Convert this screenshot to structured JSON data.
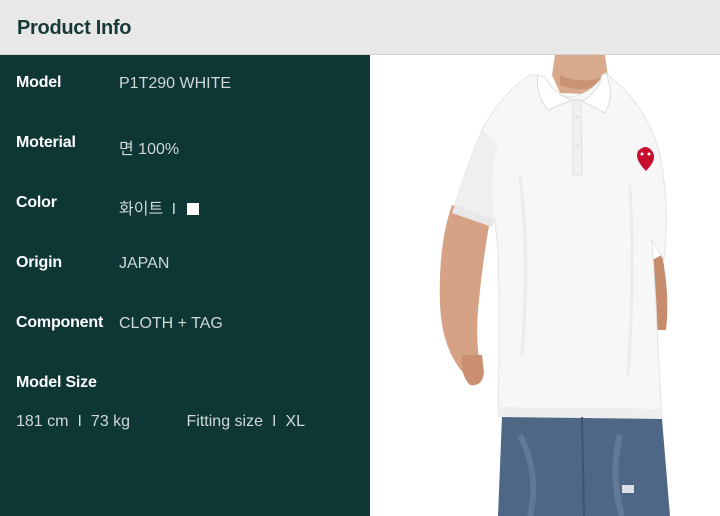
{
  "header": {
    "title": "Product Info"
  },
  "info": [
    {
      "label": "Model",
      "value": "P1T290 WHITE"
    },
    {
      "label": "Moterial",
      "value": "면 100%"
    },
    {
      "label": "Color",
      "value": "화이트",
      "separator": "I"
    },
    {
      "label": "Origin",
      "value": "JAPAN"
    },
    {
      "label": "Component",
      "value": "CLOTH + TAG"
    }
  ],
  "model_size": {
    "label": "Model Size",
    "height": "181 cm",
    "divider": "I",
    "weight": "73 kg",
    "fitting_label": "Fitting size",
    "fitting_value": "XL"
  },
  "colors": {
    "header_bg": "#e8e8e8",
    "header_text": "#173a37",
    "panel_bg": "#0e3635",
    "swatch": "#ffffff",
    "heart_logo": "#c8102e"
  }
}
